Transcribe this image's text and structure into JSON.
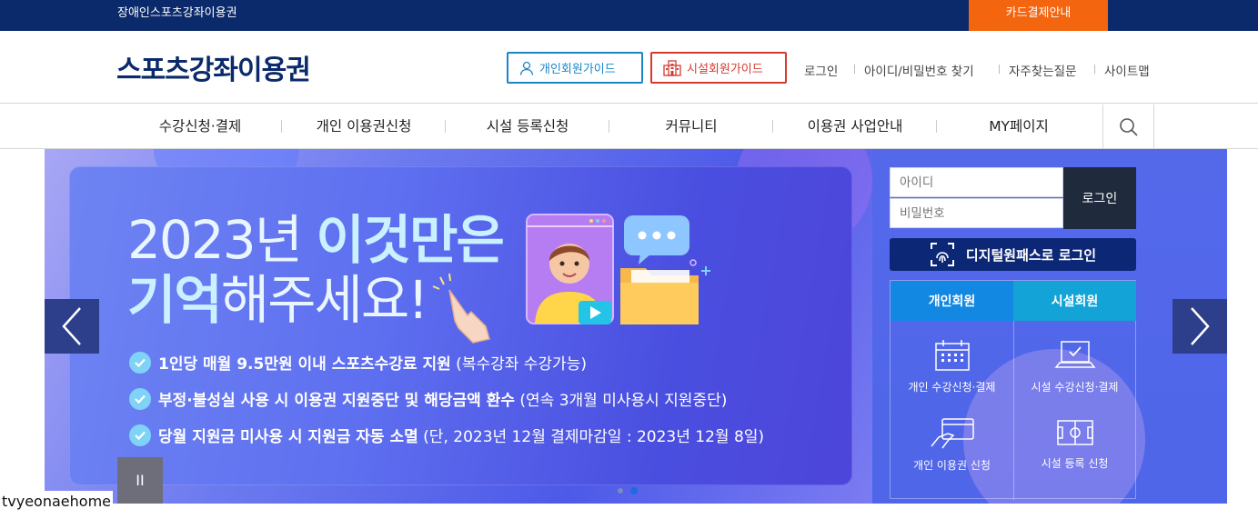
{
  "topbar": {
    "site_link": "장애인스포츠강좌이용권",
    "card_payment": "카드결제안내"
  },
  "header": {
    "logo": "스포츠강좌이용권",
    "guide_personal": "개인회원가이드",
    "guide_facility": "시설회원가이드",
    "util_links": [
      "로그인",
      "아이디/비밀번호 찾기",
      "자주찾는질문",
      "사이트맵"
    ]
  },
  "nav": {
    "items": [
      "수강신청·결제",
      "개인 이용권신청",
      "시설 등록신청",
      "커뮤니티",
      "이용권 사업안내",
      "MY페이지"
    ]
  },
  "banner": {
    "line1_normal": "2023년 ",
    "line1_bold": "이것만은",
    "line2_bold": "기억",
    "line2_normal": "해주세요!",
    "bullets": [
      {
        "bold": "1인당 매월 9.5만원 이내 스포츠수강료 지원",
        "normal": " (복수강좌 수강가능)"
      },
      {
        "bold": "부정·불성실 사용 시 이용권 지원중단 및 해당금액 환수",
        "normal": " (연속 3개월 미사용시 지원중단)"
      },
      {
        "bold": "당월 지원금 미사용 시 지원금 자동 소멸",
        "normal": " (단, 2023년 12월 결제마감일 : 2023년 12월 8일)"
      }
    ],
    "pause_label": "II",
    "slide_count": 2,
    "active_slide": 2
  },
  "login": {
    "id_placeholder": "아이디",
    "pw_placeholder": "비밀번호",
    "login_button": "로그인",
    "onepass_button": "디지털원패스로 로그인"
  },
  "member": {
    "tab_personal": "개인회원",
    "tab_facility": "시설회원",
    "services": [
      {
        "label": "개인 수강신청·결제",
        "icon": "calendar-icon"
      },
      {
        "label": "시설 수강신청·결제",
        "icon": "laptop-check-icon"
      },
      {
        "label": "개인 이용권 신청",
        "icon": "card-hand-icon"
      },
      {
        "label": "시설 등록 신청",
        "icon": "stadium-icon"
      }
    ]
  },
  "watermark": "tvyeonaehome",
  "colors": {
    "topbar": "#0b2a6b",
    "card_button": "#f4650f",
    "logo": "#0b2a6b",
    "guide_personal": "#1d86c8",
    "guide_facility": "#d63a2f",
    "tab_personal": "#1388e3",
    "tab_facility": "#14a3d6"
  }
}
